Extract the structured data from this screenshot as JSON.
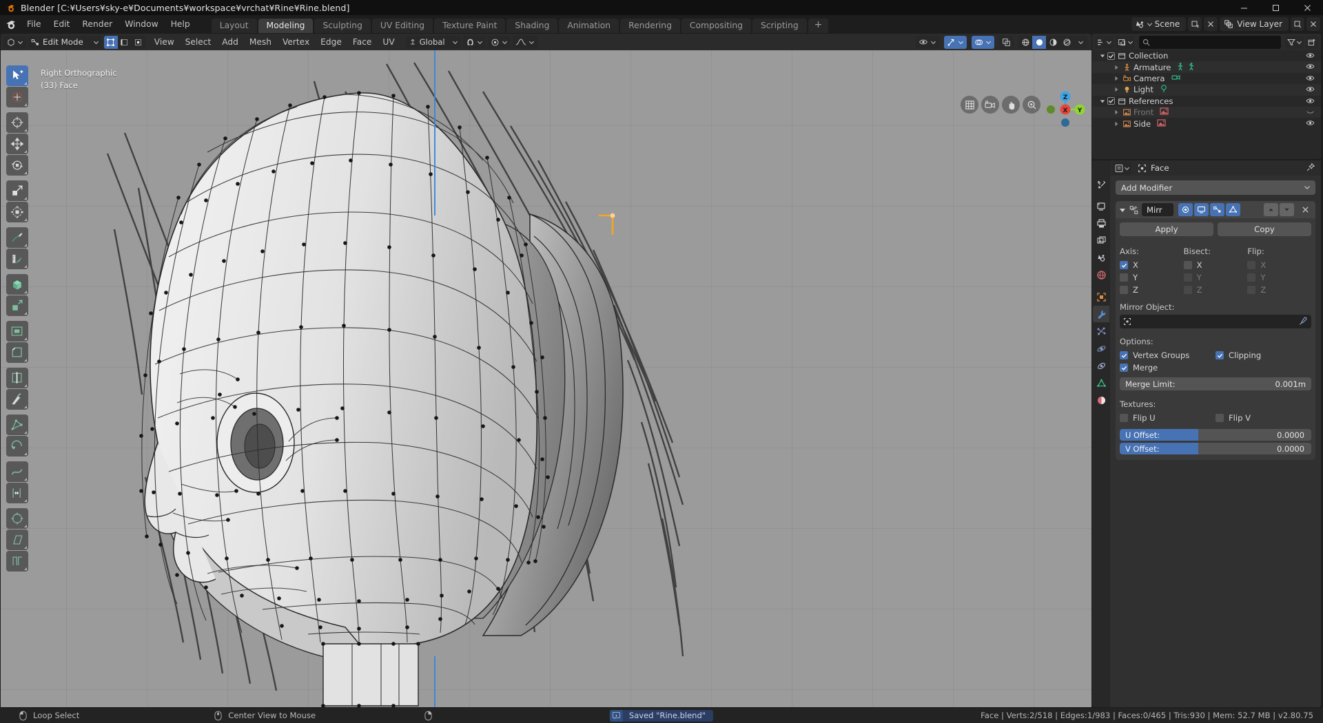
{
  "window": {
    "title": "Blender [C:¥Users¥sky-e¥Documents¥workspace¥vrchat¥Rine¥Rine.blend]",
    "minimize": "–",
    "maximize": "▢",
    "close": "✕"
  },
  "menubar": {
    "items": [
      "File",
      "Edit",
      "Render",
      "Window",
      "Help"
    ]
  },
  "workspaces": {
    "tabs": [
      "Layout",
      "Modeling",
      "Sculpting",
      "UV Editing",
      "Texture Paint",
      "Shading",
      "Animation",
      "Rendering",
      "Compositing",
      "Scripting"
    ],
    "active": "Modeling",
    "add_label": "+"
  },
  "topbar_right": {
    "scene_label": "Scene",
    "view_layer_label": "View Layer",
    "scene_icon": "scene-icon",
    "view_layer_icon": "view-layer-icon",
    "new_scene_icon": "new-scene-icon",
    "remove_scene_icon": "remove-scene-icon",
    "new_layer_icon": "new-layer-icon",
    "remove_layer_icon": "remove-layer-icon"
  },
  "viewport_header": {
    "editor_type_icon": "editor-type-icon",
    "mode": "Edit Mode",
    "select_modes": [
      "vertex-select-icon",
      "edge-select-icon",
      "face-select-icon"
    ],
    "select_mode_active": "vertex-select-icon",
    "menus": [
      "View",
      "Select",
      "Add",
      "Mesh",
      "Vertex",
      "Edge",
      "Face",
      "UV"
    ],
    "transform_orientation": "Global",
    "snap_icon": "magnet-icon",
    "proportional_icon": "proportional-editing-icon",
    "pivot_icon": "pivot-point-icon",
    "show_gizmo_icon": "gizmo-icon",
    "overlays_icon": "overlays-icon",
    "xray_icon": "xray-icon",
    "shading_modes": [
      "wireframe-shading-icon",
      "solid-shading-icon",
      "material-shading-icon",
      "rendered-shading-icon"
    ],
    "shading_active": "solid-shading-icon",
    "visibility_icon": "visibility-icon"
  },
  "viewport": {
    "view_name": "Right Orthographic",
    "object_info": "(33) Face",
    "gizmo_axes": [
      {
        "label": "Z",
        "color": "#3da3e8"
      },
      {
        "label": "X",
        "color": "#e8443c"
      },
      {
        "label": "Y",
        "color": "#8fd631"
      }
    ],
    "nav_buttons": [
      "zoom-region-icon",
      "move-view-icon",
      "camera-view-icon",
      "toggle-ortho-icon"
    ]
  },
  "toolbar": {
    "tools": [
      {
        "name": "tweak-tool",
        "active": true
      },
      {
        "name": "select-box-tool",
        "active": false
      },
      {
        "name": "cursor-tool",
        "active": false
      },
      {
        "name": "move-tool",
        "active": false
      },
      {
        "name": "rotate-tool",
        "active": false
      },
      {
        "name": "scale-tool",
        "active": false
      },
      {
        "name": "transform-tool",
        "active": false
      },
      {
        "name": "annotate-tool",
        "active": false
      },
      {
        "name": "measure-tool",
        "active": false
      },
      {
        "name": "add-cube-tool",
        "active": false
      },
      {
        "name": "extrude-region-tool",
        "active": false
      },
      {
        "name": "inset-faces-tool",
        "active": false
      },
      {
        "name": "bevel-tool",
        "active": false
      },
      {
        "name": "loop-cut-tool",
        "active": false
      },
      {
        "name": "knife-tool",
        "active": false
      },
      {
        "name": "poly-build-tool",
        "active": false
      },
      {
        "name": "spin-tool",
        "active": false
      },
      {
        "name": "smooth-tool",
        "active": false
      },
      {
        "name": "edge-slide-tool",
        "active": false
      },
      {
        "name": "shrink-fatten-tool",
        "active": false
      },
      {
        "name": "shear-tool",
        "active": false
      },
      {
        "name": "rip-region-tool",
        "active": false
      }
    ]
  },
  "outliner": {
    "display_mode_icon": "display-mode-icon",
    "filter_icon": "filter-icon",
    "new_collection_icon": "new-collection-icon",
    "search_placeholder": "",
    "search_value": "",
    "rows": [
      {
        "label": "Collection",
        "icon": "collection-icon",
        "indent": 0,
        "expanded": true,
        "checkbox": true,
        "visible": true,
        "dim": false,
        "badges": []
      },
      {
        "label": "Armature",
        "icon": "armature-icon",
        "indent": 1,
        "expanded": false,
        "checkbox": false,
        "visible": true,
        "dim": false,
        "badges": [
          "armature-data-icon",
          "pose-icon"
        ]
      },
      {
        "label": "Camera",
        "icon": "camera-icon",
        "indent": 1,
        "expanded": false,
        "checkbox": false,
        "visible": true,
        "dim": false,
        "badges": [
          "camera-data-icon"
        ]
      },
      {
        "label": "Light",
        "icon": "light-icon",
        "indent": 1,
        "expanded": false,
        "checkbox": false,
        "visible": true,
        "dim": false,
        "badges": [
          "light-data-icon"
        ]
      },
      {
        "label": "References",
        "icon": "collection-icon",
        "indent": 0,
        "expanded": true,
        "checkbox": true,
        "visible": true,
        "dim": false,
        "badges": []
      },
      {
        "label": "Front",
        "icon": "image-icon",
        "indent": 1,
        "expanded": false,
        "checkbox": false,
        "visible": false,
        "dim": true,
        "badges": [
          "image-data-icon"
        ]
      },
      {
        "label": "Side",
        "icon": "image-icon",
        "indent": 1,
        "expanded": false,
        "checkbox": false,
        "visible": true,
        "dim": false,
        "badges": [
          "image-data-icon"
        ]
      }
    ]
  },
  "properties": {
    "tabs": [
      {
        "name": "tool-tab",
        "active": false,
        "gap": false
      },
      {
        "name": "render-tab",
        "active": false,
        "gap": true
      },
      {
        "name": "output-tab",
        "active": false,
        "gap": false
      },
      {
        "name": "view-layer-tab",
        "active": false,
        "gap": false
      },
      {
        "name": "scene-tab",
        "active": false,
        "gap": false
      },
      {
        "name": "world-tab",
        "active": false,
        "gap": false
      },
      {
        "name": "object-tab",
        "active": false,
        "gap": true
      },
      {
        "name": "modifier-tab",
        "active": true,
        "gap": false
      },
      {
        "name": "particles-tab",
        "active": false,
        "gap": false
      },
      {
        "name": "physics-tab",
        "active": false,
        "gap": false
      },
      {
        "name": "constraints-tab",
        "active": false,
        "gap": false
      },
      {
        "name": "object-data-tab",
        "active": false,
        "gap": false
      },
      {
        "name": "material-tab",
        "active": false,
        "gap": false
      }
    ],
    "breadcrumb_object": "Face",
    "breadcrumb_icon": "object-data-icon",
    "pin_icon": "pin-icon",
    "editor_icon": "properties-editor-icon",
    "add_modifier_label": "Add Modifier",
    "modifier": {
      "expand_icon": "triangle-down-icon",
      "type_icon": "mirror-modifier-icon",
      "name": "Mirr",
      "toggles": [
        {
          "name": "render-toggle-icon",
          "on": true
        },
        {
          "name": "realtime-toggle-icon",
          "on": true
        },
        {
          "name": "edit-mode-toggle-icon",
          "on": true
        },
        {
          "name": "on-cage-toggle-icon",
          "on": true
        }
      ],
      "move_up_icon": "arrow-up-icon",
      "move_down_icon": "arrow-down-icon",
      "close_icon": "x-icon",
      "apply_label": "Apply",
      "copy_label": "Copy",
      "axis_label": "Axis:",
      "bisect_label": "Bisect:",
      "flip_label": "Flip:",
      "axis": [
        {
          "label": "X",
          "checked": true,
          "enabled": true
        },
        {
          "label": "Y",
          "checked": false,
          "enabled": true
        },
        {
          "label": "Z",
          "checked": false,
          "enabled": true
        }
      ],
      "bisect": [
        {
          "label": "X",
          "checked": false,
          "enabled": true
        },
        {
          "label": "Y",
          "checked": false,
          "enabled": false
        },
        {
          "label": "Z",
          "checked": false,
          "enabled": false
        }
      ],
      "flip": [
        {
          "label": "X",
          "checked": false,
          "enabled": false
        },
        {
          "label": "Y",
          "checked": false,
          "enabled": false
        },
        {
          "label": "Z",
          "checked": false,
          "enabled": false
        }
      ],
      "mirror_object_label": "Mirror Object:",
      "mirror_object_value": "",
      "mirror_object_icon": "object-picker-icon",
      "eyedropper_icon": "eyedropper-icon",
      "options_label": "Options:",
      "options": [
        {
          "label": "Vertex Groups",
          "checked": true
        },
        {
          "label": "Clipping",
          "checked": true
        },
        {
          "label": "Merge",
          "checked": true
        }
      ],
      "merge_limit_label": "Merge Limit:",
      "merge_limit_value": "0.001m",
      "textures_label": "Textures:",
      "textures": [
        {
          "label": "Flip U",
          "checked": false
        },
        {
          "label": "Flip V",
          "checked": false
        }
      ],
      "offsets": [
        {
          "label": "U Offset:",
          "value": "0.0000"
        },
        {
          "label": "V Offset:",
          "value": "0.0000"
        }
      ]
    }
  },
  "statusbar": {
    "hints": [
      {
        "icon": "mouse-left-icon",
        "label": "Loop Select"
      },
      {
        "icon": "mouse-middle-icon",
        "label": "Center View to Mouse"
      },
      {
        "icon": "mouse-right-icon",
        "label": ""
      }
    ],
    "toast": {
      "icon": "info-icon",
      "text": "Saved \"Rine.blend\""
    },
    "stats": "Face | Verts:2/518 | Edges:1/983 | Faces:0/465 | Tris:930 | Mem: 52.7 MB | v2.80.75"
  },
  "colors": {
    "accent_blue": "#4772b3",
    "viewport_bg": "#9b9b9b",
    "panel_bg": "#303030",
    "header_bg": "#2b2b2b",
    "axis_x": "#e8443c",
    "axis_y": "#8fd631",
    "axis_z": "#3da3e8",
    "selected_edge": "#f5a623"
  }
}
